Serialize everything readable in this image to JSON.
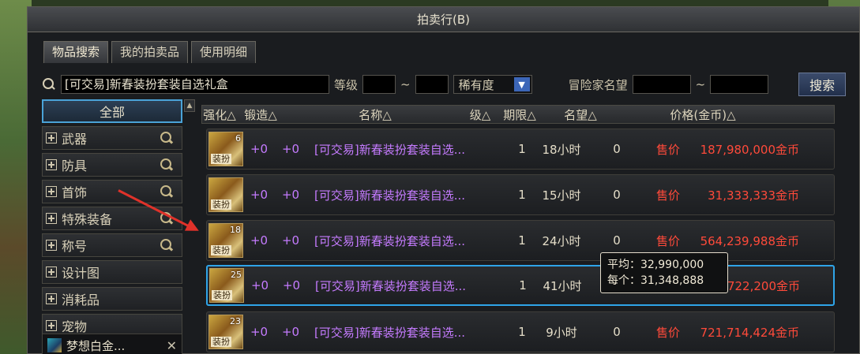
{
  "window": {
    "title": "拍卖行(B)"
  },
  "tabs": [
    {
      "label": "物品搜索",
      "active": true
    },
    {
      "label": "我的拍卖品",
      "active": false
    },
    {
      "label": "使用明细",
      "active": false
    }
  ],
  "search": {
    "query": "[可交易]新春装扮套装自选礼盒",
    "level_label": "等级",
    "level_min": "",
    "level_max": "",
    "range_sep": "~",
    "rarity_label": "稀有度",
    "fame_label": "冒险家名望",
    "fame_min": "",
    "fame_max": "",
    "button": "搜索"
  },
  "sidebar": {
    "all": "全部",
    "items": [
      {
        "label": "武器",
        "zoom": true
      },
      {
        "label": "防具",
        "zoom": true
      },
      {
        "label": "首饰",
        "zoom": true
      },
      {
        "label": "特殊装备",
        "zoom": true
      },
      {
        "label": "称号",
        "zoom": true
      },
      {
        "label": "设计图",
        "zoom": false
      },
      {
        "label": "消耗品",
        "zoom": false
      },
      {
        "label": "宠物",
        "zoom": false
      }
    ],
    "favorite": "梦想白金..."
  },
  "table": {
    "headers": {
      "strengthen": "强化△",
      "forge": "锻造△",
      "name": "名称△",
      "level": "级△",
      "period": "期限△",
      "fame": "名望△",
      "price": "价格(金币)△"
    },
    "rows": [
      {
        "count": "6",
        "tag": "装扮",
        "str": "+0",
        "forge": "+0",
        "name": "[可交易]新春装扮套装自选...",
        "level": "1",
        "time": "18小时",
        "fame": "0",
        "sale": "售价",
        "price": "187,980,000金币"
      },
      {
        "count": "",
        "tag": "装扮",
        "str": "+0",
        "forge": "+0",
        "name": "[可交易]新春装扮套装自选...",
        "level": "1",
        "time": "15小时",
        "fame": "0",
        "sale": "售价",
        "price": "31,333,333金币"
      },
      {
        "count": "18",
        "tag": "装扮",
        "str": "+0",
        "forge": "+0",
        "name": "[可交易]新春装扮套装自选...",
        "level": "1",
        "time": "24小时",
        "fame": "0",
        "sale": "售价",
        "price": "564,239,988金币"
      },
      {
        "count": "25",
        "tag": "装扮",
        "str": "+0",
        "forge": "+0",
        "name": "[可交易]新春装扮套装自选...",
        "level": "1",
        "time": "41小时",
        "fame": "0",
        "sale": "",
        "price": "33,722,200金币"
      },
      {
        "count": "23",
        "tag": "装扮",
        "str": "+0",
        "forge": "+0",
        "name": "[可交易]新春装扮套装自选...",
        "level": "1",
        "time": "9小时",
        "fame": "0",
        "sale": "售价",
        "price": "721,714,424金币"
      }
    ]
  },
  "tooltip": {
    "avg_label": "平均：",
    "avg_value": "32,990,000",
    "each_label": "每个：",
    "each_value": "31,348,888"
  },
  "colors": {
    "selected_border": "#2fa4e8",
    "price_red": "#ff4a3a",
    "name_purple": "#c57bff",
    "arrow_red": "#e0322a"
  }
}
